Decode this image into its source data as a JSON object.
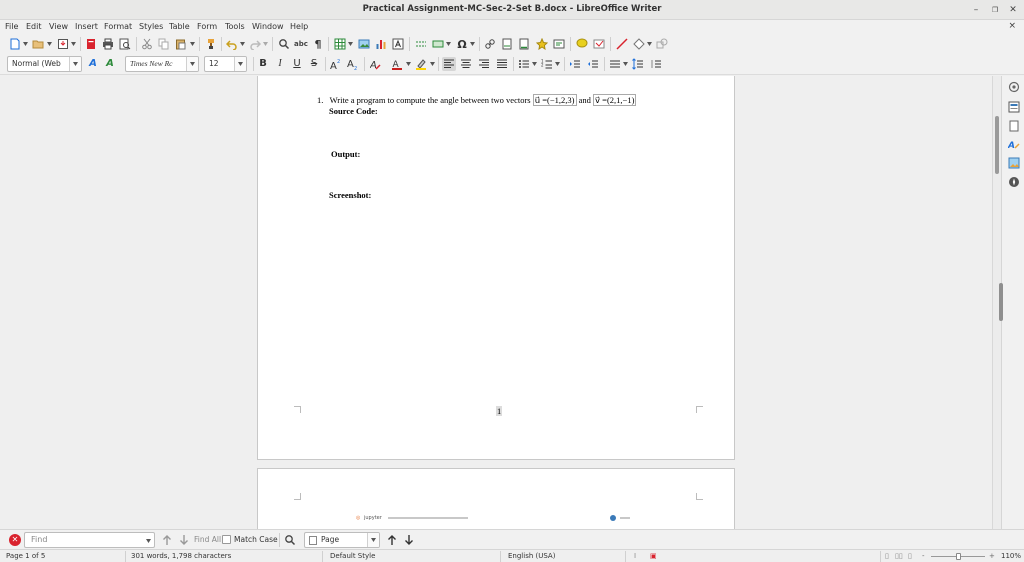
{
  "window": {
    "title": "Practical Assignment-MC-Sec-2-Set B.docx - LibreOffice Writer",
    "close_doc_glyph": "×"
  },
  "menus": [
    "File",
    "Edit",
    "View",
    "Insert",
    "Format",
    "Styles",
    "Table",
    "Form",
    "Tools",
    "Window",
    "Help"
  ],
  "format_toolbar": {
    "paragraph_style": "Normal (Web",
    "font_name": "Times New Rc",
    "font_size": "12",
    "bold": "B",
    "italic": "I",
    "underline": "U",
    "strike": "S"
  },
  "document": {
    "question_number": "1.",
    "question_text": "Write a program to compute the angle between two vectors",
    "vector_u": "u⃗ =(−1,2,3)",
    "conjunction": "and",
    "vector_v": "v⃗ =(2,1,−1)",
    "source_code_label": "Source Code:",
    "output_label": "Output:",
    "screenshot_label": "Screenshot:",
    "page_number": "1",
    "embedded_screenshot_text": "jupyter"
  },
  "findbar": {
    "placeholder": "Find",
    "find_all": "Find All",
    "match_case": "Match Case",
    "navigate_by": "Page"
  },
  "status": {
    "page": "Page 1 of 5",
    "words": "301 words, 1,798 characters",
    "style": "Default Style",
    "language": "English (USA)",
    "zoom": "110%"
  },
  "colors": {
    "accent": "#1e6fd9",
    "find_close": "#d9232e",
    "font_color": "#c9211e",
    "highlight": "#ffd400"
  }
}
